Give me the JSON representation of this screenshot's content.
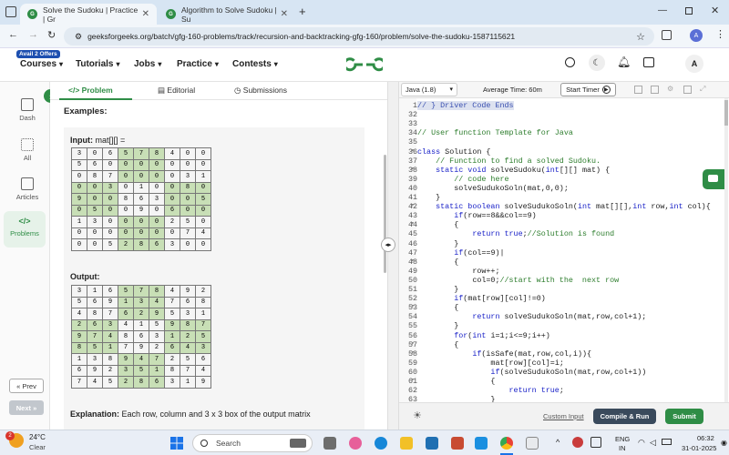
{
  "browser": {
    "tabs": [
      {
        "title": "Solve the Sudoku | Practice | Gr",
        "active": true
      },
      {
        "title": "Algorithm to Solve Sudoku | Su",
        "active": false
      }
    ],
    "new_tab": "+",
    "url": "geeksforgeeks.org/batch/gfg-160-problems/track/recursion-and-backtracking-gfg-160/problem/solve-the-sudoku-1587115621",
    "profile_initial": "A"
  },
  "site": {
    "offer_badge": "Avail 2 Offers",
    "nav": [
      "Courses",
      "Tutorials",
      "Jobs",
      "Practice",
      "Contests"
    ],
    "logo": "GfG",
    "user_initial": "A"
  },
  "rail": {
    "items": [
      "Dash",
      "All",
      "Articles",
      "Problems"
    ],
    "prev": "« Prev",
    "next": "Next »"
  },
  "problem_tabs": [
    "</> Problem",
    "Editorial",
    "Submissions"
  ],
  "problem": {
    "heading": "Examples:",
    "input_label": "Input:",
    "input_expr": "mat[][] =",
    "output_label": "Output:",
    "explanation_label": "Explanation:",
    "explanation_text": "Each row, column and 3 x 3 box of the output matrix",
    "input_grid": [
      [
        3,
        0,
        6,
        5,
        7,
        8,
        4,
        0,
        0
      ],
      [
        5,
        6,
        0,
        0,
        0,
        0,
        0,
        0,
        0
      ],
      [
        0,
        8,
        7,
        0,
        0,
        0,
        0,
        3,
        1
      ],
      [
        0,
        0,
        3,
        0,
        1,
        0,
        0,
        8,
        0
      ],
      [
        9,
        0,
        0,
        8,
        6,
        3,
        0,
        0,
        5
      ],
      [
        0,
        5,
        0,
        0,
        9,
        0,
        6,
        0,
        0
      ],
      [
        1,
        3,
        0,
        0,
        0,
        0,
        2,
        5,
        0
      ],
      [
        0,
        0,
        0,
        0,
        0,
        0,
        0,
        7,
        4
      ],
      [
        0,
        0,
        5,
        2,
        8,
        6,
        3,
        0,
        0
      ]
    ],
    "output_grid": [
      [
        3,
        1,
        6,
        5,
        7,
        8,
        4,
        9,
        2
      ],
      [
        5,
        6,
        9,
        1,
        3,
        4,
        7,
        6,
        8
      ],
      [
        4,
        8,
        7,
        6,
        2,
        9,
        5,
        3,
        1
      ],
      [
        2,
        6,
        3,
        4,
        1,
        5,
        9,
        8,
        7
      ],
      [
        9,
        7,
        4,
        8,
        6,
        3,
        1,
        2,
        5
      ],
      [
        8,
        5,
        1,
        7,
        9,
        2,
        6,
        4,
        3
      ],
      [
        1,
        3,
        8,
        9,
        4,
        7,
        2,
        5,
        6
      ],
      [
        6,
        9,
        2,
        3,
        5,
        1,
        8,
        7,
        4
      ],
      [
        7,
        4,
        5,
        2,
        8,
        6,
        3,
        1,
        9
      ]
    ]
  },
  "editor": {
    "language": "Java (1.8)",
    "avg_time": "Average Time: 60m",
    "start_timer": "Start Timer",
    "lines": [
      {
        "n": 1,
        "t": "// } Driver Code Ends",
        "c": "cm"
      },
      {
        "n": 32,
        "t": "",
        "c": ""
      },
      {
        "n": 33,
        "t": "",
        "c": ""
      },
      {
        "n": 34,
        "t": "// User function Template for Java",
        "c": "cm"
      },
      {
        "n": 35,
        "t": "",
        "c": ""
      },
      {
        "n": 36,
        "t": "class Solution {",
        "c": ""
      },
      {
        "n": 37,
        "t": "    // Function to find a solved Sudoku.",
        "c": "cm"
      },
      {
        "n": 38,
        "t": "    static void solveSudoku(int[][] mat) {",
        "c": ""
      },
      {
        "n": 39,
        "t": "        // code here",
        "c": "cm"
      },
      {
        "n": 40,
        "t": "        solveSudukoSoln(mat,0,0);",
        "c": ""
      },
      {
        "n": 41,
        "t": "    }",
        "c": ""
      },
      {
        "n": 42,
        "t": "    static boolean solveSudukoSoln(int mat[][],int row,int col){",
        "c": ""
      },
      {
        "n": 43,
        "t": "        if(row==8&&col==9)",
        "c": ""
      },
      {
        "n": 44,
        "t": "        {",
        "c": ""
      },
      {
        "n": 45,
        "t": "            return true;//Solution is found",
        "c": ""
      },
      {
        "n": 46,
        "t": "        }",
        "c": ""
      },
      {
        "n": 47,
        "t": "        if(col==9)|",
        "c": ""
      },
      {
        "n": 48,
        "t": "        {",
        "c": ""
      },
      {
        "n": 49,
        "t": "            row++;",
        "c": ""
      },
      {
        "n": 50,
        "t": "            col=0;//start with the  next row",
        "c": ""
      },
      {
        "n": 51,
        "t": "        }",
        "c": ""
      },
      {
        "n": 52,
        "t": "        if(mat[row][col]!=0)",
        "c": ""
      },
      {
        "n": 53,
        "t": "        {",
        "c": ""
      },
      {
        "n": 54,
        "t": "            return solveSudukoSoln(mat,row,col+1);",
        "c": ""
      },
      {
        "n": 55,
        "t": "        }",
        "c": ""
      },
      {
        "n": 56,
        "t": "        for(int i=1;i<=9;i++)",
        "c": ""
      },
      {
        "n": 57,
        "t": "        {",
        "c": ""
      },
      {
        "n": 58,
        "t": "            if(isSafe(mat,row,col,i)){",
        "c": ""
      },
      {
        "n": 59,
        "t": "                mat[row][col]=i;",
        "c": ""
      },
      {
        "n": 60,
        "t": "                if(solveSudukoSoln(mat,row,col+1))",
        "c": ""
      },
      {
        "n": 61,
        "t": "                {",
        "c": ""
      },
      {
        "n": 62,
        "t": "                    return true;",
        "c": ""
      },
      {
        "n": 63,
        "t": "                }",
        "c": ""
      }
    ],
    "custom_input": "Custom Input",
    "compile_run": "Compile & Run",
    "submit": "Submit"
  },
  "taskbar": {
    "temp": "24°C",
    "weather": "Clear",
    "search_placeholder": "Search",
    "lang": "ENG",
    "region": "IN",
    "time": "06:32",
    "date": "31-01-2025",
    "weather_badge": "2"
  },
  "colors": {
    "gfg_green": "#2f8d46",
    "cell_green": "#c8dfb6",
    "compile_btn": "#3a4a5c",
    "submit_btn": "#2f8d46"
  }
}
